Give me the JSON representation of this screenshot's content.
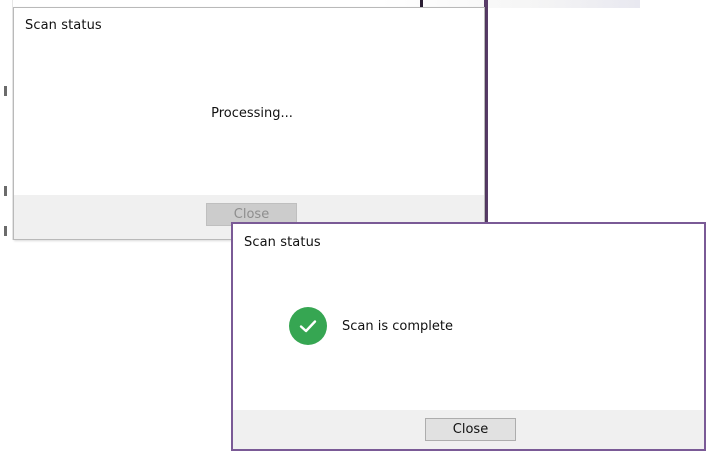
{
  "dialogs": {
    "processing": {
      "title": "Scan status",
      "message": "Processing...",
      "close_label": "Close"
    },
    "complete": {
      "title": "Scan status",
      "message": "Scan is complete",
      "close_label": "Close",
      "status_icon": "check-circle-icon"
    }
  },
  "colors": {
    "success_green": "#36a652",
    "dialog_border_active": "#7a5a96",
    "footer_bg": "#f0f0f0",
    "disabled_button_bg": "#cccccc",
    "button_bg": "#e1e1e1"
  }
}
